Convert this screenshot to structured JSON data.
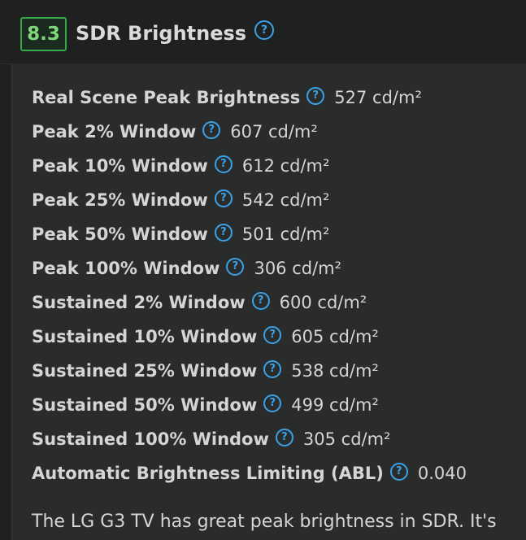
{
  "header": {
    "score": "8.3",
    "title": "SDR Brightness",
    "help_glyph": "?"
  },
  "measurements": [
    {
      "label": "Real Scene Peak Brightness",
      "value": "527 cd/m²"
    },
    {
      "label": "Peak 2% Window",
      "value": "607 cd/m²"
    },
    {
      "label": "Peak 10% Window",
      "value": "612 cd/m²"
    },
    {
      "label": "Peak 25% Window",
      "value": "542 cd/m²"
    },
    {
      "label": "Peak 50% Window",
      "value": "501 cd/m²"
    },
    {
      "label": "Peak 100% Window",
      "value": "306 cd/m²"
    },
    {
      "label": "Sustained 2% Window",
      "value": "600 cd/m²"
    },
    {
      "label": "Sustained 10% Window",
      "value": "605 cd/m²"
    },
    {
      "label": "Sustained 25% Window",
      "value": "538 cd/m²"
    },
    {
      "label": "Sustained 50% Window",
      "value": "499 cd/m²"
    },
    {
      "label": "Sustained 100% Window",
      "value": "305 cd/m²"
    },
    {
      "label": "Automatic Brightness Limiting (ABL)",
      "value": "0.040"
    }
  ],
  "summary": "The LG G3 TV has great peak brightness in SDR. It's",
  "colors": {
    "background": "#1f2020",
    "panel": "#2a2b2b",
    "score_border": "#36a84a",
    "score_text": "#7fd77d",
    "help_icon": "#39a2e8",
    "text": "#d4d5d5"
  },
  "icons": {
    "help": "question-circle-icon"
  }
}
